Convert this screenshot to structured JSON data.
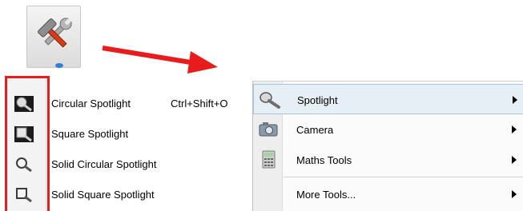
{
  "toolbar": {
    "tools_icon": "hammer-wrench-icon",
    "arrow_color": "#e81c1c"
  },
  "submenu": {
    "items": [
      {
        "label": "Circular Spotlight",
        "shortcut": "Ctrl+Shift+O",
        "icon": "circular-spotlight-icon"
      },
      {
        "label": "Square Spotlight",
        "shortcut": "",
        "icon": "square-spotlight-icon"
      },
      {
        "label": "Solid Circular Spotlight",
        "shortcut": "",
        "icon": "solid-circular-spotlight-icon"
      },
      {
        "label": "Solid Square Spotlight",
        "shortcut": "",
        "icon": "solid-square-spotlight-icon"
      }
    ],
    "highlight_color": "#e81c1c"
  },
  "menu": {
    "items": [
      {
        "label": "Spotlight",
        "icon": "spotlight-icon",
        "has_submenu": true,
        "highlighted": true
      },
      {
        "label": "Camera",
        "icon": "camera-icon",
        "has_submenu": true,
        "highlighted": false
      },
      {
        "label": "Maths Tools",
        "icon": "calculator-icon",
        "has_submenu": true,
        "highlighted": false
      },
      {
        "label": "More Tools...",
        "icon": "",
        "has_submenu": true,
        "highlighted": false
      }
    ],
    "highlight_color": "#e6eef6"
  }
}
